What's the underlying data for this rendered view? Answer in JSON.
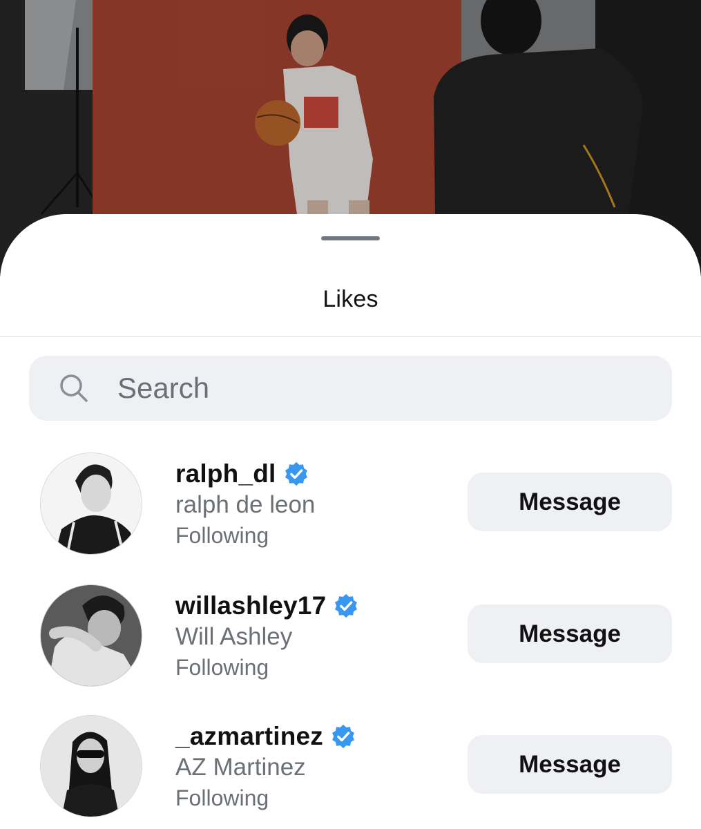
{
  "sheet": {
    "title": "Likes"
  },
  "search": {
    "placeholder": "Search",
    "value": ""
  },
  "likes": [
    {
      "username": "ralph_dl",
      "full_name": "ralph de leon",
      "status": "Following",
      "verified": true,
      "action_label": "Message"
    },
    {
      "username": "willashley17",
      "full_name": "Will Ashley",
      "status": "Following",
      "verified": true,
      "action_label": "Message"
    },
    {
      "username": "_azmartinez",
      "full_name": "AZ Martinez",
      "status": "Following",
      "verified": true,
      "action_label": "Message"
    }
  ],
  "colors": {
    "verified_badge": "#3897f0",
    "button_bg": "#eff0f4",
    "secondary_text": "#6b6f76"
  },
  "icons": [
    "search-icon",
    "verified-badge-icon"
  ]
}
